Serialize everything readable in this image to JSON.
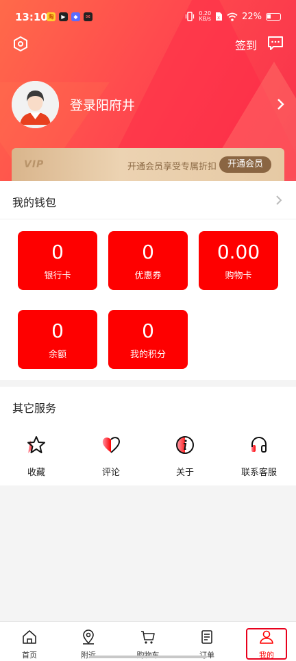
{
  "status_bar": {
    "time": "13:10",
    "network_speed": "0.20",
    "network_unit": "KB/s",
    "battery_percent": "22%"
  },
  "header": {
    "signin_label": "签到",
    "username": "登录阳府井",
    "vip": {
      "badge": "VIP",
      "description": "开通会员享受专属折扣",
      "button_label": "开通会员"
    },
    "colors": {
      "primary": "#fe0000",
      "header_red": "#ff4a4e",
      "vip_gold": "#8a6542"
    }
  },
  "wallet": {
    "title": "我的钱包",
    "items": [
      {
        "value": "0",
        "label": "银行卡"
      },
      {
        "value": "0",
        "label": "优惠券"
      },
      {
        "value": "0.00",
        "label": "购物卡"
      },
      {
        "value": "0",
        "label": "余额"
      },
      {
        "value": "0",
        "label": "我的积分"
      }
    ]
  },
  "services": {
    "title": "其它服务",
    "items": [
      {
        "label": "收藏",
        "icon": "star-icon"
      },
      {
        "label": "评论",
        "icon": "heart-icon"
      },
      {
        "label": "关于",
        "icon": "info-icon"
      },
      {
        "label": "联系客服",
        "icon": "headset-icon"
      }
    ]
  },
  "bottom_nav": {
    "items": [
      {
        "label": "首页",
        "icon": "home-icon"
      },
      {
        "label": "附近",
        "icon": "location-icon"
      },
      {
        "label": "购物车",
        "icon": "cart-icon"
      },
      {
        "label": "订单",
        "icon": "order-icon"
      },
      {
        "label": "我的",
        "icon": "user-icon",
        "active": true
      }
    ]
  }
}
